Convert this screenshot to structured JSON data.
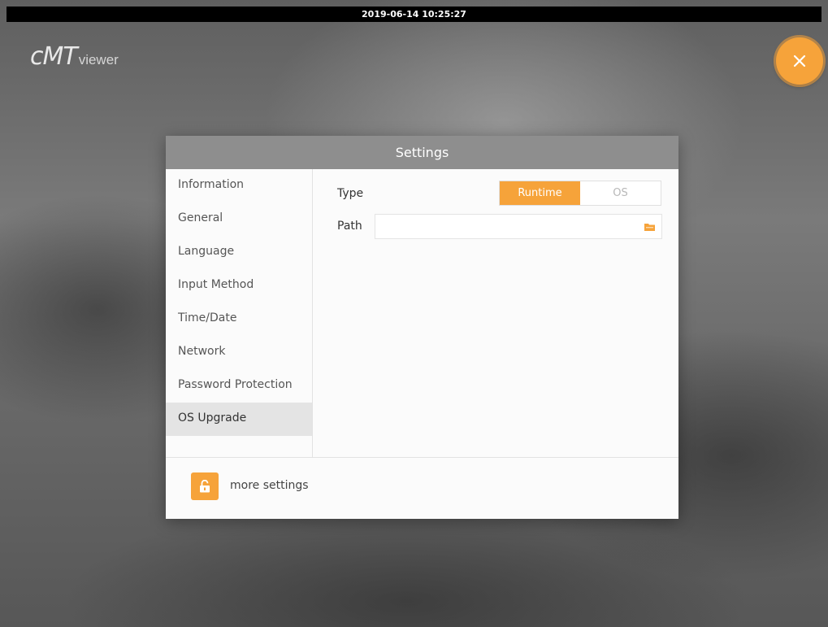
{
  "status_bar": {
    "datetime": "2019-06-14 10:25:27"
  },
  "logo": {
    "main": "cMT",
    "sub": "viewer"
  },
  "close_button": {
    "icon": "close-icon"
  },
  "dialog": {
    "title": "Settings",
    "sidebar": {
      "items": [
        {
          "label": "Information"
        },
        {
          "label": "General"
        },
        {
          "label": "Language"
        },
        {
          "label": "Input Method"
        },
        {
          "label": "Time/Date"
        },
        {
          "label": "Network"
        },
        {
          "label": "Password Protection"
        },
        {
          "label": "OS Upgrade",
          "selected": true
        }
      ]
    },
    "content": {
      "type_label": "Type",
      "type_options": [
        "Runtime",
        "OS"
      ],
      "type_selected": "Runtime",
      "path_label": "Path",
      "path_value": "",
      "path_icon": "folder-icon"
    },
    "footer": {
      "more_label": "more settings",
      "icon": "unlock-icon"
    }
  },
  "colors": {
    "accent": "#f6a33a",
    "header": "#8e8e8e",
    "selected_item": "#e4e4e4"
  }
}
